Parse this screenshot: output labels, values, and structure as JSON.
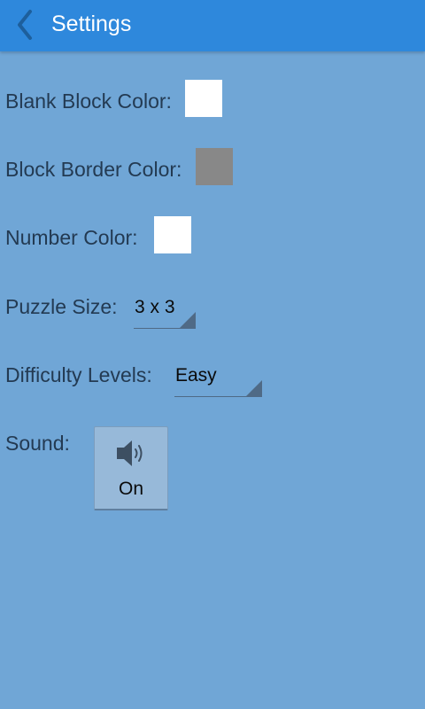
{
  "appbar": {
    "title": "Settings",
    "back_icon": "chevron-left-icon"
  },
  "settings": {
    "blank_block_color": {
      "label": "Blank Block Color:",
      "color": "#ffffff"
    },
    "block_border_color": {
      "label": "Block Border Color:",
      "color": "#888888"
    },
    "number_color": {
      "label": "Number Color:",
      "color": "#ffffff"
    },
    "puzzle_size": {
      "label": "Puzzle Size:",
      "value": "3 x 3"
    },
    "difficulty": {
      "label": "Difficulty Levels:",
      "value": "Easy"
    },
    "sound": {
      "label": "Sound:",
      "state": "On",
      "icon": "speaker-icon"
    }
  },
  "colors": {
    "appbar": "#2e88dc",
    "background": "#70a6d6",
    "label_text": "#233a52"
  }
}
